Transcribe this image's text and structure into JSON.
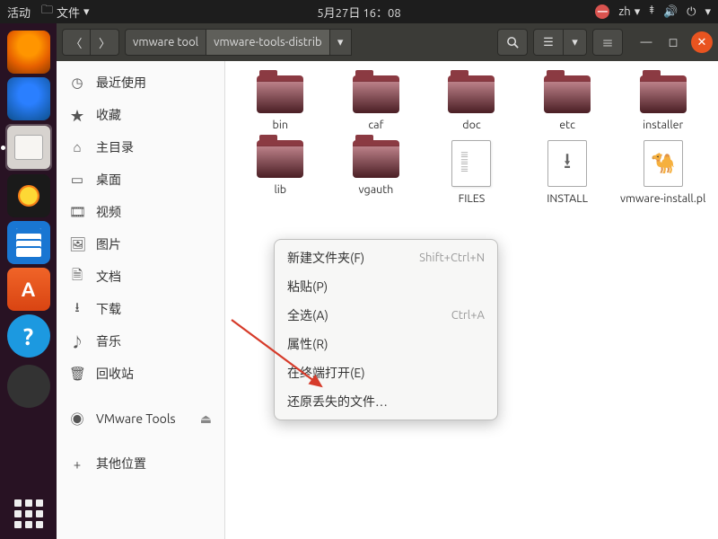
{
  "topbar": {
    "activities": "活动",
    "app_menu": "文件",
    "datetime": "5月27日 16：08",
    "ime": "zh"
  },
  "headerbar": {
    "path1": "vmware tool",
    "path2": "vmware-tools-distrib"
  },
  "sidebar": {
    "recent": "最近使用",
    "starred": "收藏",
    "home": "主目录",
    "desktop": "桌面",
    "videos": "视频",
    "pictures": "图片",
    "documents": "文档",
    "downloads": "下载",
    "music": "音乐",
    "trash": "回收站",
    "vmtools": "VMware Tools",
    "other": "其他位置"
  },
  "files": {
    "bin": "bin",
    "caf": "caf",
    "doc": "doc",
    "etc": "etc",
    "installer": "installer",
    "lib": "lib",
    "vgauth": "vgauth",
    "FILES": "FILES",
    "INSTALL": "INSTALL",
    "script": "vmware-install.pl"
  },
  "ctx": {
    "new_folder": "新建文件夹(F)",
    "new_folder_sc": "Shift+Ctrl+N",
    "paste": "粘贴(P)",
    "select_all": "全选(A)",
    "select_all_sc": "Ctrl+A",
    "properties": "属性(R)",
    "open_terminal": "在终端打开(E)",
    "restore": "还原丢失的文件…"
  }
}
